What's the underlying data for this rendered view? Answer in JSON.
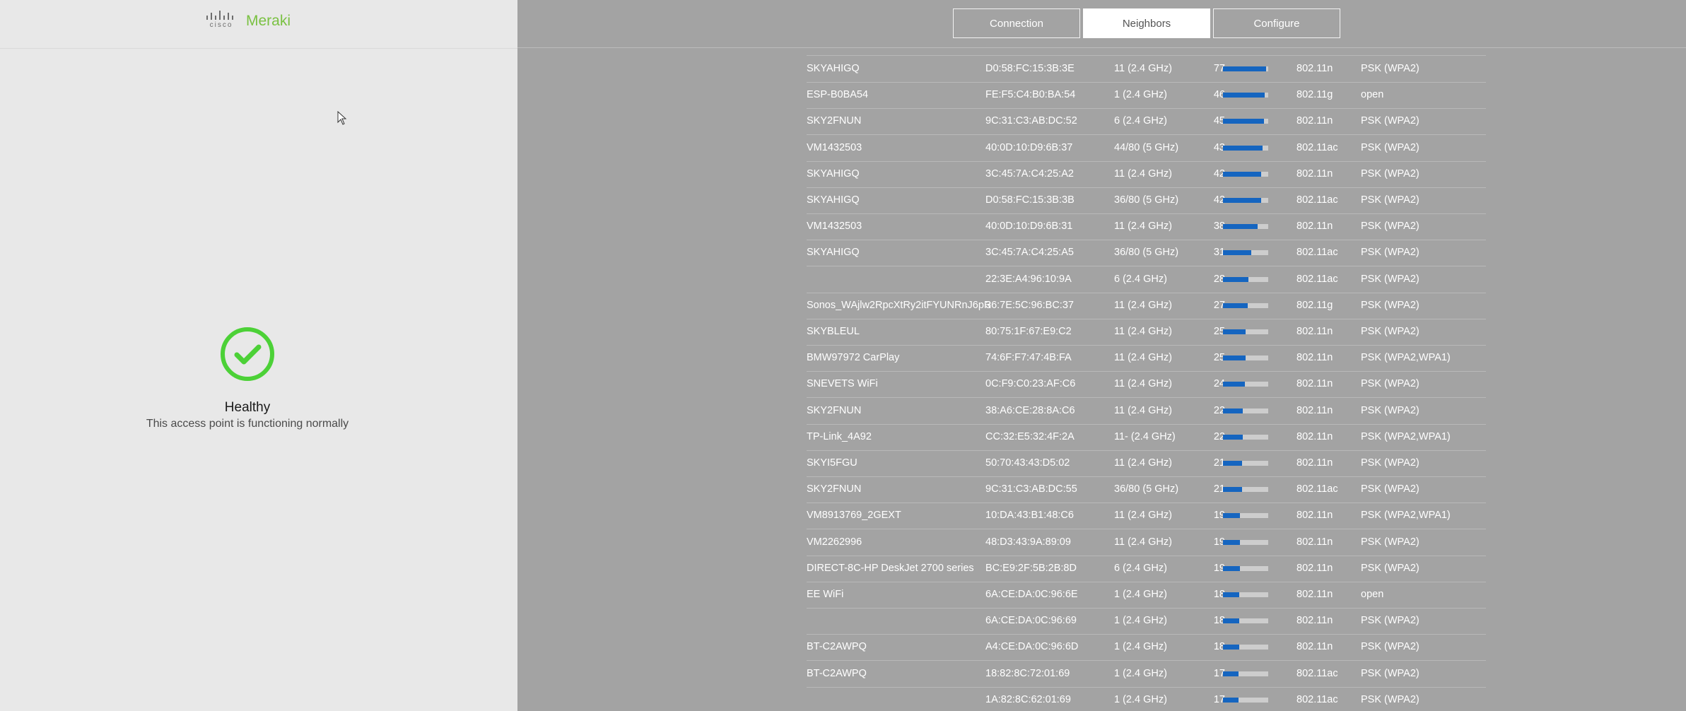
{
  "brand": {
    "vendor": "cisco",
    "product": "Meraki"
  },
  "status": {
    "title": "Healthy",
    "subtitle": "This access point is functioning normally",
    "color": "#4cd137"
  },
  "tabs": [
    {
      "label": "Connection",
      "active": false
    },
    {
      "label": "Neighbors",
      "active": true
    },
    {
      "label": "Configure",
      "active": false
    }
  ],
  "accent": "#1565c0",
  "neighbors": [
    {
      "ssid": "SKYAHIGQ",
      "bssid": "D0:58:FC:15:3B:3E",
      "channel": "11 (2.4 GHz)",
      "snr": "77",
      "signal": 0.95,
      "mode": "802.11n",
      "encryption": "PSK (WPA2)"
    },
    {
      "ssid": "ESP-B0BA54",
      "bssid": "FE:F5:C4:B0:BA:54",
      "channel": "1 (2.4 GHz)",
      "snr": "46",
      "signal": 0.92,
      "mode": "802.11g",
      "encryption": "open"
    },
    {
      "ssid": "SKY2FNUN",
      "bssid": "9C:31:C3:AB:DC:52",
      "channel": "6 (2.4 GHz)",
      "snr": "45",
      "signal": 0.9,
      "mode": "802.11n",
      "encryption": "PSK (WPA2)"
    },
    {
      "ssid": "VM1432503",
      "bssid": "40:0D:10:D9:6B:37",
      "channel": "44/80 (5 GHz)",
      "snr": "43",
      "signal": 0.87,
      "mode": "802.11ac",
      "encryption": "PSK (WPA2)"
    },
    {
      "ssid": "SKYAHIGQ",
      "bssid": "3C:45:7A:C4:25:A2",
      "channel": "11 (2.4 GHz)",
      "snr": "42",
      "signal": 0.84,
      "mode": "802.11n",
      "encryption": "PSK (WPA2)"
    },
    {
      "ssid": "SKYAHIGQ",
      "bssid": "D0:58:FC:15:3B:3B",
      "channel": "36/80 (5 GHz)",
      "snr": "42",
      "signal": 0.84,
      "mode": "802.11ac",
      "encryption": "PSK (WPA2)"
    },
    {
      "ssid": "VM1432503",
      "bssid": "40:0D:10:D9:6B:31",
      "channel": "11 (2.4 GHz)",
      "snr": "38",
      "signal": 0.76,
      "mode": "802.11n",
      "encryption": "PSK (WPA2)"
    },
    {
      "ssid": "SKYAHIGQ",
      "bssid": "3C:45:7A:C4:25:A5",
      "channel": "36/80 (5 GHz)",
      "snr": "31",
      "signal": 0.62,
      "mode": "802.11ac",
      "encryption": "PSK (WPA2)"
    },
    {
      "ssid": "",
      "bssid": "22:3E:A4:96:10:9A",
      "channel": "6 (2.4 GHz)",
      "snr": "28",
      "signal": 0.56,
      "mode": "802.11ac",
      "encryption": "PSK (WPA2)"
    },
    {
      "ssid": "Sonos_WAjlw2RpcXtRy2itFYUNRnJ6pR",
      "bssid": "36:7E:5C:96:BC:37",
      "channel": "11 (2.4 GHz)",
      "snr": "27",
      "signal": 0.54,
      "mode": "802.11g",
      "encryption": "PSK (WPA2)"
    },
    {
      "ssid": "SKYBLEUL",
      "bssid": "80:75:1F:67:E9:C2",
      "channel": "11 (2.4 GHz)",
      "snr": "25",
      "signal": 0.5,
      "mode": "802.11n",
      "encryption": "PSK (WPA2)"
    },
    {
      "ssid": "BMW97972 CarPlay",
      "bssid": "74:6F:F7:47:4B:FA",
      "channel": "11 (2.4 GHz)",
      "snr": "25",
      "signal": 0.5,
      "mode": "802.11n",
      "encryption": "PSK (WPA2,WPA1)"
    },
    {
      "ssid": "SNEVETS WiFi",
      "bssid": "0C:F9:C0:23:AF:C6",
      "channel": "11 (2.4 GHz)",
      "snr": "24",
      "signal": 0.48,
      "mode": "802.11n",
      "encryption": "PSK (WPA2)"
    },
    {
      "ssid": "SKY2FNUN",
      "bssid": "38:A6:CE:28:8A:C6",
      "channel": "11 (2.4 GHz)",
      "snr": "22",
      "signal": 0.44,
      "mode": "802.11n",
      "encryption": "PSK (WPA2)"
    },
    {
      "ssid": "TP-Link_4A92",
      "bssid": "CC:32:E5:32:4F:2A",
      "channel": "11- (2.4 GHz)",
      "snr": "22",
      "signal": 0.44,
      "mode": "802.11n",
      "encryption": "PSK (WPA2,WPA1)"
    },
    {
      "ssid": "SKYI5FGU",
      "bssid": "50:70:43:43:D5:02",
      "channel": "11 (2.4 GHz)",
      "snr": "21",
      "signal": 0.42,
      "mode": "802.11n",
      "encryption": "PSK (WPA2)"
    },
    {
      "ssid": "SKY2FNUN",
      "bssid": "9C:31:C3:AB:DC:55",
      "channel": "36/80 (5 GHz)",
      "snr": "21",
      "signal": 0.42,
      "mode": "802.11ac",
      "encryption": "PSK (WPA2)"
    },
    {
      "ssid": "VM8913769_2GEXT",
      "bssid": "10:DA:43:B1:48:C6",
      "channel": "11 (2.4 GHz)",
      "snr": "19",
      "signal": 0.38,
      "mode": "802.11n",
      "encryption": "PSK (WPA2,WPA1)"
    },
    {
      "ssid": "VM2262996",
      "bssid": "48:D3:43:9A:89:09",
      "channel": "11 (2.4 GHz)",
      "snr": "19",
      "signal": 0.38,
      "mode": "802.11n",
      "encryption": "PSK (WPA2)"
    },
    {
      "ssid": "DIRECT-8C-HP DeskJet 2700 series",
      "bssid": "BC:E9:2F:5B:2B:8D",
      "channel": "6 (2.4 GHz)",
      "snr": "19",
      "signal": 0.38,
      "mode": "802.11n",
      "encryption": "PSK (WPA2)"
    },
    {
      "ssid": "EE WiFi",
      "bssid": "6A:CE:DA:0C:96:6E",
      "channel": "1 (2.4 GHz)",
      "snr": "18",
      "signal": 0.36,
      "mode": "802.11n",
      "encryption": "open"
    },
    {
      "ssid": "",
      "bssid": "6A:CE:DA:0C:96:69",
      "channel": "1 (2.4 GHz)",
      "snr": "18",
      "signal": 0.36,
      "mode": "802.11n",
      "encryption": "PSK (WPA2)"
    },
    {
      "ssid": "BT-C2AWPQ",
      "bssid": "A4:CE:DA:0C:96:6D",
      "channel": "1 (2.4 GHz)",
      "snr": "18",
      "signal": 0.36,
      "mode": "802.11n",
      "encryption": "PSK (WPA2)"
    },
    {
      "ssid": "BT-C2AWPQ",
      "bssid": "18:82:8C:72:01:69",
      "channel": "1 (2.4 GHz)",
      "snr": "17",
      "signal": 0.34,
      "mode": "802.11ac",
      "encryption": "PSK (WPA2)"
    },
    {
      "ssid": "",
      "bssid": "1A:82:8C:62:01:69",
      "channel": "1 (2.4 GHz)",
      "snr": "17",
      "signal": 0.34,
      "mode": "802.11ac",
      "encryption": "PSK (WPA2)"
    }
  ]
}
